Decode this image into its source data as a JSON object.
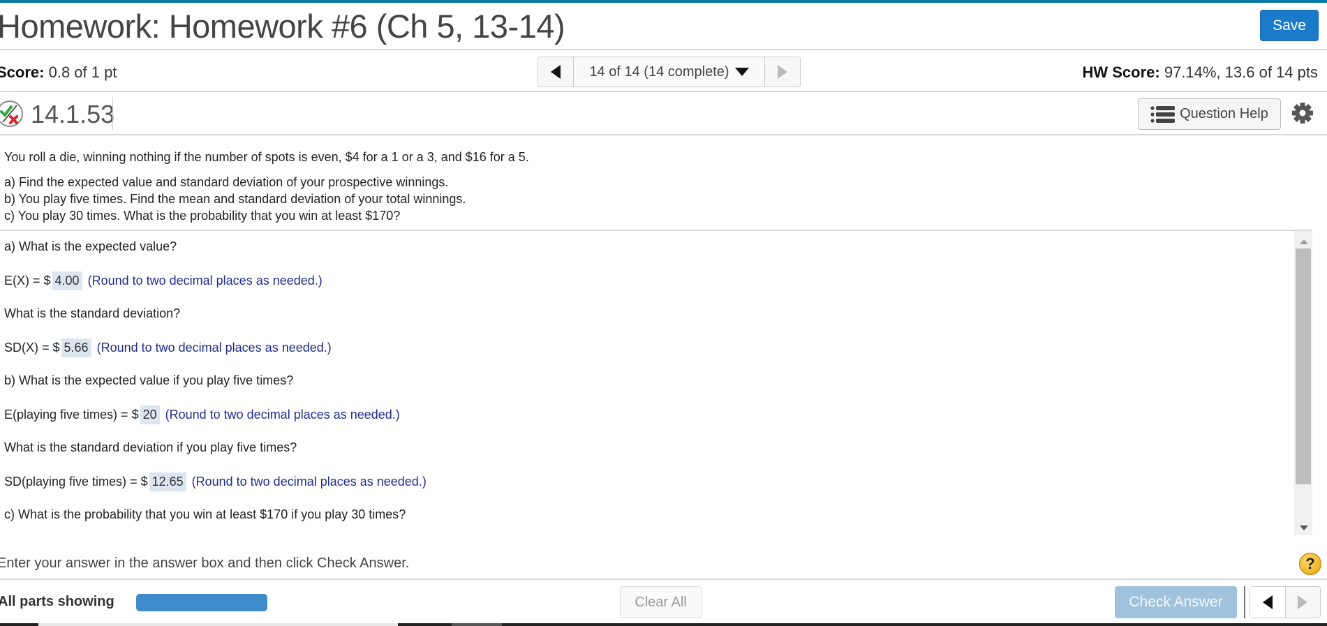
{
  "header": {
    "title": "Homework: Homework #6 (Ch 5, 13-14)",
    "save_label": "Save"
  },
  "score_row": {
    "score_label": "Score:",
    "score_value": "0.8 of 1 pt",
    "nav_position": "14 of 14 (14 complete)",
    "hw_score_label": "HW Score:",
    "hw_score_value": "97.14%, 13.6 of 14 pts"
  },
  "question": {
    "status_icon": "partially-correct-icon",
    "number": "14.1.53",
    "help_label": "Question Help"
  },
  "problem": {
    "lead": "You roll a die, winning nothing if the number of spots is even, $4 for a 1 or a 3, and $16 for a 5.",
    "parts": [
      "a) Find the expected value and standard deviation of your prospective winnings.",
      "b) You play five times. Find the mean and standard deviation of your total winnings.",
      "c) You play 30 times. What is the probability that you win at least $170?"
    ]
  },
  "answers": {
    "q_a1": "a) What is the expected value?",
    "ex_prefix": "E(X) = $",
    "ex_value": "4.00",
    "q_a2": "What is the standard deviation?",
    "sdx_prefix": "SD(X) = $",
    "sdx_value": "5.66",
    "q_b1": "b) What is the expected value if you play five times?",
    "e5_prefix": "E(playing five times) = $",
    "e5_value": "20",
    "q_b2": "What is the standard deviation if you play five times?",
    "sd5_prefix": "SD(playing five times) = $",
    "sd5_value": "12.65",
    "q_c": "c) What is the probability that you win at least $170 if you play 30 times?",
    "hint": "(Round to two decimal places as needed.)"
  },
  "footer": {
    "instruction": "Enter your answer in the answer box and then click Check Answer.",
    "parts_label": "All parts showing",
    "clear_label": "Clear All",
    "check_label": "Check Answer"
  },
  "colors": {
    "accent": "#1a7ac9",
    "hint": "#1f2d8f",
    "answer_bg": "#dde5f0",
    "check_disabled": "#a0c2dc"
  }
}
